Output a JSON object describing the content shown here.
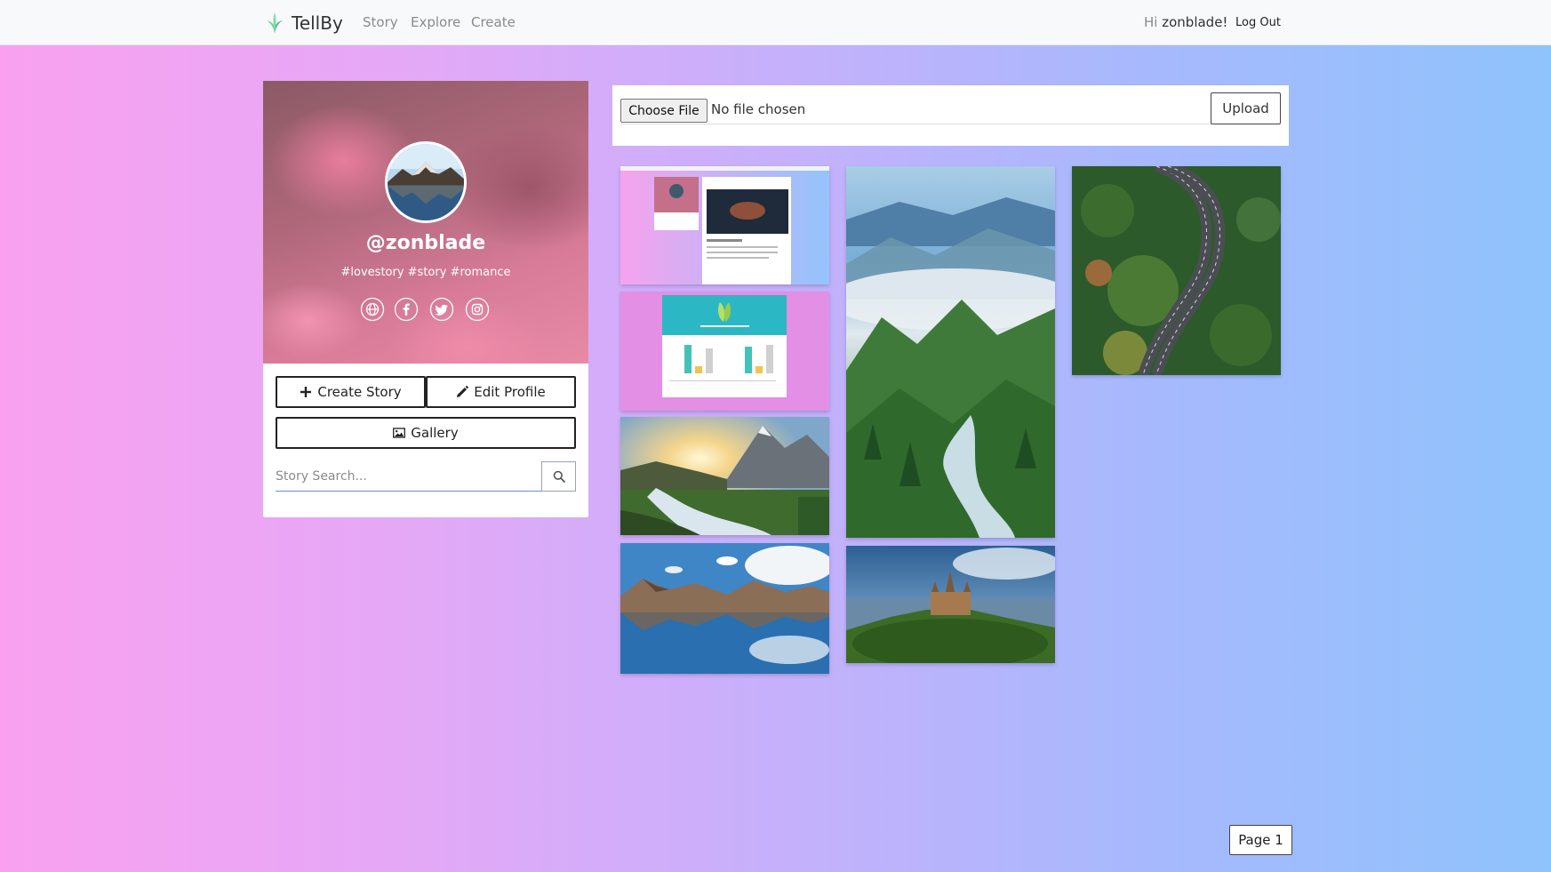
{
  "app": {
    "brand": "TellBy",
    "accent_color": "#6bcf9a"
  },
  "nav": {
    "links": [
      "Story",
      "Explore",
      "Create"
    ],
    "greeting_prefix": "Hi",
    "username": "zonblade!",
    "logout_label": "Log Out"
  },
  "profile": {
    "handle": "@zonblade",
    "tags": "#lovestory #story #romance",
    "social_icons": [
      "globe-icon",
      "facebook-icon",
      "twitter-icon",
      "instagram-icon"
    ],
    "create_story_label": "Create Story",
    "edit_profile_label": "Edit Profile",
    "gallery_label": "Gallery",
    "search_placeholder": "Story Search..."
  },
  "upload": {
    "choose_file_label": "Choose File",
    "file_status": "No file chosen",
    "upload_label": "Upload"
  },
  "gallery": {
    "images": [
      "screenshot of profile page",
      "screenshot of chart dashboard",
      "mountain waterfall at sunset",
      "lake reflecting mountains",
      "misty green mountain valley with river",
      "castle on forested hill",
      "aerial view of road through forest"
    ]
  },
  "pagination": {
    "label": "Page 1"
  }
}
